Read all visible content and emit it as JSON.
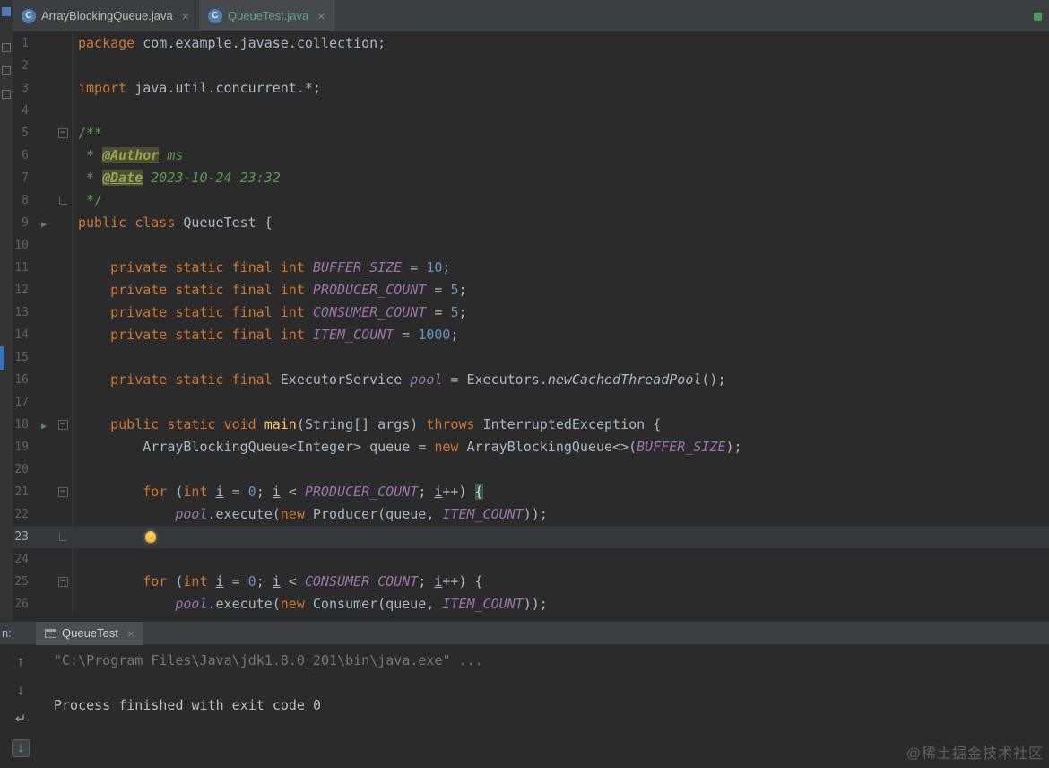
{
  "window": {
    "app": "IntelliJ IDEA style Java IDE"
  },
  "colors": {
    "editor_bg": "#2b2b2b",
    "panel_bg": "#3c3f41",
    "keyword": "#cc7832",
    "constant": "#9876aa",
    "number": "#6897bb",
    "comment": "#629755",
    "method": "#ffc66b",
    "default_text": "#a9b7c6",
    "active_tab_text": "#5fa396",
    "run_green": "#4c9b57",
    "caret_line": "#34383c",
    "bulb_yellow": "#e9a33a",
    "marker_blue": "#3873b5"
  },
  "icons": {
    "close": "×",
    "class_letter": "C",
    "run": "▶",
    "up": "↑",
    "down": "↓",
    "wrap": "↵",
    "scroll_end": "↓",
    "fold_minus": "−"
  },
  "tabs": [
    {
      "label": "ArrayBlockingQueue.java",
      "active": false
    },
    {
      "label": "QueueTest.java",
      "active": true
    }
  ],
  "editor": {
    "lines": [
      {
        "n": 1,
        "seg": [
          [
            "k",
            "package"
          ],
          [
            "d",
            " com.example.javase.collection;"
          ]
        ]
      },
      {
        "n": 2,
        "seg": []
      },
      {
        "n": 3,
        "seg": [
          [
            "k",
            "import"
          ],
          [
            "d",
            " java.util.concurrent.*;"
          ]
        ]
      },
      {
        "n": 4,
        "seg": []
      },
      {
        "n": 5,
        "fold": "start",
        "seg": [
          [
            "cm",
            "/**"
          ]
        ]
      },
      {
        "n": 6,
        "seg": [
          [
            "cm",
            " * "
          ],
          [
            "tg",
            "@Author"
          ],
          [
            "cm",
            " "
          ],
          [
            "tv",
            "ms"
          ]
        ]
      },
      {
        "n": 7,
        "seg": [
          [
            "cm",
            " * "
          ],
          [
            "tg",
            "@Date"
          ],
          [
            "cm",
            " "
          ],
          [
            "tv",
            "2023-10-24 23:32"
          ]
        ]
      },
      {
        "n": 8,
        "fold": "end",
        "seg": [
          [
            "cm",
            " */"
          ]
        ]
      },
      {
        "n": 9,
        "run": true,
        "seg": [
          [
            "k",
            "public class"
          ],
          [
            "d",
            " QueueTest {"
          ]
        ]
      },
      {
        "n": 10,
        "seg": []
      },
      {
        "n": 11,
        "seg": [
          [
            "d",
            "    "
          ],
          [
            "k",
            "private static final int"
          ],
          [
            "d",
            " "
          ],
          [
            "c",
            "BUFFER_SIZE"
          ],
          [
            "d",
            " = "
          ],
          [
            "n",
            "10"
          ],
          [
            "d",
            ";"
          ]
        ]
      },
      {
        "n": 12,
        "seg": [
          [
            "d",
            "    "
          ],
          [
            "k",
            "private static final int"
          ],
          [
            "d",
            " "
          ],
          [
            "c",
            "PRODUCER_COUNT"
          ],
          [
            "d",
            " = "
          ],
          [
            "n",
            "5"
          ],
          [
            "d",
            ";"
          ]
        ]
      },
      {
        "n": 13,
        "seg": [
          [
            "d",
            "    "
          ],
          [
            "k",
            "private static final int"
          ],
          [
            "d",
            " "
          ],
          [
            "c",
            "CONSUMER_COUNT"
          ],
          [
            "d",
            " = "
          ],
          [
            "n",
            "5"
          ],
          [
            "d",
            ";"
          ]
        ]
      },
      {
        "n": 14,
        "seg": [
          [
            "d",
            "    "
          ],
          [
            "k",
            "private static final int"
          ],
          [
            "d",
            " "
          ],
          [
            "c",
            "ITEM_COUNT"
          ],
          [
            "d",
            " = "
          ],
          [
            "n",
            "1000"
          ],
          [
            "d",
            ";"
          ]
        ]
      },
      {
        "n": 15,
        "seg": []
      },
      {
        "n": 16,
        "seg": [
          [
            "d",
            "    "
          ],
          [
            "k",
            "private static final"
          ],
          [
            "d",
            " ExecutorService "
          ],
          [
            "c",
            "pool"
          ],
          [
            "d",
            " = Executors."
          ],
          [
            "itd",
            "newCachedThreadPool"
          ],
          [
            "d",
            "();"
          ]
        ]
      },
      {
        "n": 17,
        "seg": []
      },
      {
        "n": 18,
        "run": true,
        "fold": "start",
        "seg": [
          [
            "d",
            "    "
          ],
          [
            "k",
            "public static void"
          ],
          [
            "d",
            " "
          ],
          [
            "m",
            "main"
          ],
          [
            "d",
            "(String[] args) "
          ],
          [
            "k",
            "throws"
          ],
          [
            "d",
            " InterruptedException {"
          ]
        ]
      },
      {
        "n": 19,
        "seg": [
          [
            "d",
            "        ArrayBlockingQueue<Integer> queue = "
          ],
          [
            "k",
            "new"
          ],
          [
            "d",
            " ArrayBlockingQueue<>("
          ],
          [
            "c",
            "BUFFER_SIZE"
          ],
          [
            "d",
            ");"
          ]
        ]
      },
      {
        "n": 20,
        "seg": []
      },
      {
        "n": 21,
        "fold": "start",
        "seg": [
          [
            "d",
            "        "
          ],
          [
            "k",
            "for"
          ],
          [
            "d",
            " ("
          ],
          [
            "k",
            "int"
          ],
          [
            "d",
            " "
          ],
          [
            "u",
            "i"
          ],
          [
            "d",
            " = "
          ],
          [
            "n",
            "0"
          ],
          [
            "d",
            "; "
          ],
          [
            "u",
            "i"
          ],
          [
            "d",
            " < "
          ],
          [
            "c",
            "PRODUCER_COUNT"
          ],
          [
            "d",
            "; "
          ],
          [
            "u",
            "i"
          ],
          [
            "d",
            "++) "
          ],
          [
            "bm",
            "{"
          ]
        ]
      },
      {
        "n": 22,
        "seg": [
          [
            "d",
            "            "
          ],
          [
            "c",
            "pool"
          ],
          [
            "d",
            ".execute("
          ],
          [
            "k",
            "new"
          ],
          [
            "d",
            " Producer(queue, "
          ],
          [
            "c",
            "ITEM_COUNT"
          ],
          [
            "d",
            "));"
          ]
        ]
      },
      {
        "n": 23,
        "fold": "end",
        "caret": true,
        "bulb": true,
        "seg": [
          [
            "d",
            "        "
          ]
        ]
      },
      {
        "n": 24,
        "seg": []
      },
      {
        "n": 25,
        "fold": "start",
        "seg": [
          [
            "d",
            "        "
          ],
          [
            "k",
            "for"
          ],
          [
            "d",
            " ("
          ],
          [
            "k",
            "int"
          ],
          [
            "d",
            " "
          ],
          [
            "u",
            "i"
          ],
          [
            "d",
            " = "
          ],
          [
            "n",
            "0"
          ],
          [
            "d",
            "; "
          ],
          [
            "u",
            "i"
          ],
          [
            "d",
            " < "
          ],
          [
            "c",
            "CONSUMER_COUNT"
          ],
          [
            "d",
            "; "
          ],
          [
            "u",
            "i"
          ],
          [
            "d",
            "++) {"
          ]
        ]
      },
      {
        "n": 26,
        "seg": [
          [
            "d",
            "            "
          ],
          [
            "c",
            "pool"
          ],
          [
            "d",
            ".execute("
          ],
          [
            "k",
            "new"
          ],
          [
            "d",
            " Consumer(queue, "
          ],
          [
            "c",
            "ITEM_COUNT"
          ],
          [
            "d",
            "));"
          ]
        ]
      }
    ]
  },
  "console": {
    "prefix": "n:",
    "tab_label": "QueueTest",
    "lines": [
      "\"C:\\Program Files\\Java\\jdk1.8.0_201\\bin\\java.exe\" ...",
      "",
      "Process finished with exit code 0"
    ]
  },
  "watermark": "@稀土掘金技术社区"
}
